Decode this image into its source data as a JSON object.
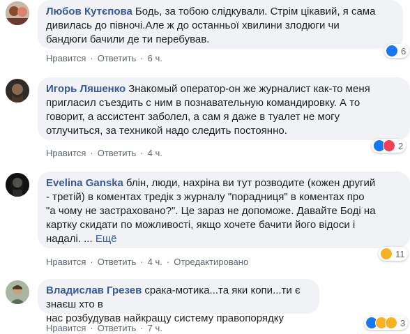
{
  "comments": [
    {
      "author": "Любов Кутєпова",
      "text_lines": [
        "Бодь, за тобою слідкували. Стрім цікавий, я сама",
        "дивилась до півночі.Але ж до останньої хвилини злодюги чи",
        "бандюги бачили де ти перебував."
      ],
      "like": "Нравится",
      "reply": "Ответить",
      "time": "6 ч.",
      "reaction_count": "6",
      "reaction_icons": [
        "like-icon"
      ]
    },
    {
      "author": "Игорь Ляшенко",
      "text_lines": [
        "Знакомый оператор-он же журналист как-то меня",
        "пригласил съездить с ним в познавательную командировку. А то",
        "говорит, а ассистент заболел, а сам я даже в туалет не могу",
        "отлучиться, за техникой надо следить постоянно."
      ],
      "like": "Нравится",
      "reply": "Ответить",
      "time": "4 ч.",
      "reaction_count": "2",
      "reaction_icons": [
        "like-icon",
        "love-icon"
      ]
    },
    {
      "author": "Evelina Ganska",
      "text_lines": [
        "блін, люди, нахріна ви тут розводите (кожен другий",
        "- третій) в коментах тредік з журналу \"порадниця\" в коментах про",
        "\"а чому не застраховано?\". Це зараз не допоможе. Давайте Боді на",
        "картку скидати по можливості, якщо хочете бачити його відоси і",
        "надалі. ..."
      ],
      "more": "Ещё",
      "like": "Нравится",
      "reply": "Ответить",
      "time": "4 ч.",
      "edited": "Отредактировано",
      "reaction_count": "11",
      "reaction_icons": [
        "haha-icon"
      ]
    },
    {
      "author": "Владислав Грезев",
      "text_lines": [
        "срака-мотика...та яки копи...ти є знаєш хто в",
        "нас розбудував найкращу систему правопорядку"
      ],
      "like": "Нравится",
      "reply": "Ответить",
      "time": "7 ч.",
      "reaction_count": "3",
      "reaction_icons": [
        "like-icon",
        "sad-icon",
        "haha-icon"
      ]
    }
  ],
  "colors": {
    "author": "#385898",
    "bubble": "#f0f2f5",
    "meta": "#606770",
    "like": "#1877f2",
    "love": "#f33e58"
  }
}
